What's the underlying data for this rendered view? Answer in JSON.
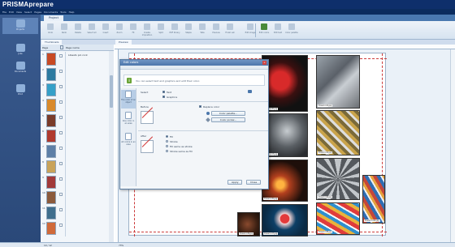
{
  "app": {
    "title": "PRISMAprepare"
  },
  "menu": [
    "File",
    "Edit",
    "View",
    "Select",
    "Pages",
    "Documents",
    "Tools",
    "Help"
  ],
  "nav": [
    {
      "label": "Projects",
      "icon": "projects-icon"
    },
    {
      "label": "Jobs",
      "icon": "jobs-icon"
    },
    {
      "label": "Documents",
      "icon": "documents-icon"
    },
    {
      "label": "Print",
      "icon": "printer-icon"
    }
  ],
  "tabs": {
    "project": "Project",
    "thumbnails": "Thumbnails",
    "preview": "Preview"
  },
  "toolbar": [
    {
      "label": "Undo",
      "icon": "undo-icon"
    },
    {
      "label": "Redo",
      "icon": "redo-icon"
    },
    {
      "label": "Delete",
      "icon": "delete-icon"
    },
    {
      "label": "Select all",
      "icon": "select-all-icon"
    },
    {
      "label": "Insert",
      "icon": "insert-icon"
    },
    {
      "label": "Zoom",
      "icon": "zoom-icon"
    },
    {
      "label": "Fit",
      "icon": "fit-icon"
    },
    {
      "label": "Create imposition",
      "icon": "imposition-icon"
    },
    {
      "label": "Split",
      "icon": "split-icon"
    },
    {
      "label": "PDF library",
      "icon": "pdf-library-icon"
    },
    {
      "label": "Staple",
      "icon": "staple-icon"
    },
    {
      "label": "Tabs",
      "icon": "tabs-icon"
    },
    {
      "label": "Preview",
      "icon": "preview-icon"
    },
    {
      "label": "Finish set",
      "icon": "finish-set-icon"
    },
    {
      "label": "Edit image",
      "icon": "edit-image-icon"
    },
    {
      "label": "Edit colors",
      "icon": "edit-colors-icon",
      "active": true
    },
    {
      "label": "Edit text",
      "icon": "edit-text-icon"
    },
    {
      "label": "Color palette",
      "icon": "color-palette-icon"
    }
  ],
  "thumb_header": {
    "col_page": "Page",
    "col_name": "Page name"
  },
  "pages": [
    {
      "num": "1",
      "name": "Libesto pin rock",
      "color": "#c84a24"
    },
    {
      "num": "2",
      "name": "",
      "color": "#2c7aa0"
    },
    {
      "num": "3",
      "name": "",
      "color": "#35a0c8"
    },
    {
      "num": "4",
      "name": "",
      "color": "#d98a2b"
    },
    {
      "num": "5",
      "name": "",
      "color": "#7a3c2a"
    },
    {
      "num": "6",
      "name": "",
      "color": "#b03a2e"
    },
    {
      "num": "7",
      "name": "",
      "color": "#5d7fa6"
    },
    {
      "num": "8",
      "name": "",
      "color": "#c9a35a"
    },
    {
      "num": "9",
      "name": "",
      "color": "#a23a3a"
    },
    {
      "num": "10",
      "name": "",
      "color": "#8b5a3c"
    },
    {
      "num": "11",
      "name": "",
      "color": "#3f6e8d"
    },
    {
      "num": "12",
      "name": "",
      "color": "#d06a3a"
    }
  ],
  "photos": [
    {
      "label": "Dreamcd0.jpg",
      "style": "radial-gradient(circle at 40% 45%,#d82a2a 0 22%,#3a1010 45%,#111 70%)"
    },
    {
      "label": "Dreamcd2.jpg",
      "style": "linear-gradient(135deg,#9aa3ab,#5a6068 40%,#c9ced3 60%,#6b6f74)"
    },
    {
      "label": "Dreamcd3.jpg",
      "style": "radial-gradient(circle at 55% 40%,#c7ccd0,#5a5f64 45%,#2a2c2f 80%)"
    },
    {
      "label": "Dreamcd4.jpg",
      "style": "repeating-linear-gradient(45deg,#c9a34a 0 4px,#7a6a3a 4px 8px,#dedede 8px 11px)"
    },
    {
      "label": "Dreamcd5.jpg",
      "style": "radial-gradient(circle at 40% 60%,#ffb340 0 10%,#b3401e 25%,#1e0f0a 65%)"
    },
    {
      "label": "Dreamcd6.jpg",
      "style": "repeating-conic-gradient(#c2c6ca 0 10deg,#55595e 10deg 25deg)"
    },
    {
      "label": "Dreamcd7.jpg",
      "style": "radial-gradient(circle at 50% 45%,#e23a3a 0 16%,#f3d3d3 18%,#0d3f66 40%,#0a2a44 75%)"
    },
    {
      "label": "Dreamcd8.jpg",
      "style": "repeating-linear-gradient(30deg,#e03c3c 0 5px,#e9b33b 5px 9px,#2f8fcf 9px 13px,#fafafa 13px 15px)"
    },
    {
      "label": "Dreamcd9.jpg",
      "style": "radial-gradient(circle at 45% 50%,#8a4a2e,#3a1f12 60%,#1a0e08)"
    },
    {
      "label": "Dreamcd10.jpg",
      "style": "repeating-linear-gradient(60deg,#c4473b 0 4px,#2f6db3 4px 8px,#eeeeee 8px 10px,#e6a23c 10px 13px)"
    }
  ],
  "dialog": {
    "title": "Edit colors",
    "info": "You can select text and graphics and edit their color.",
    "side": [
      {
        "label": "The color of an object"
      },
      {
        "label": "One color in an area"
      },
      {
        "label": "All colors in an area"
      }
    ],
    "select_label": "Select",
    "cb_text": "Text",
    "cb_graphics": "Graphics",
    "before_label": "Before",
    "replace_label": "Replace color",
    "btn_palette": "Color palette...",
    "btn_picker": "Color picker...",
    "after_label": "After",
    "opt_fill": "Fill",
    "opt_stroke": "Stroke",
    "opt_fill_stroke": "Fill same as stroke",
    "opt_stroke_fill": "Stroke same as fill",
    "btn_apply": "Apply",
    "btn_close": "Close"
  },
  "status": {
    "page": "10 / 12",
    "zoom": "73%"
  }
}
